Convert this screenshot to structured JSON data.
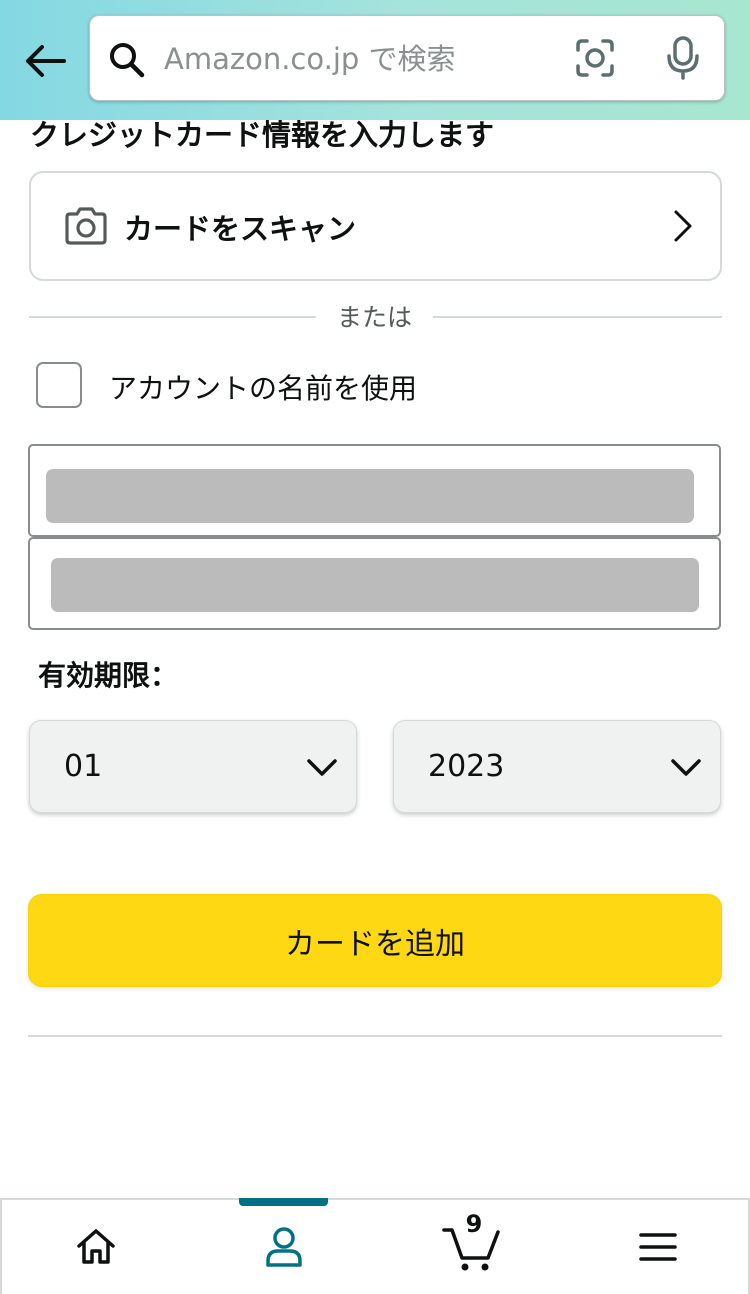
{
  "header": {
    "search_placeholder": "Amazon.co.jp で検索",
    "icons": [
      "back-arrow-icon",
      "search-icon",
      "camera-lens-icon",
      "microphone-icon"
    ]
  },
  "page": {
    "title": "クレジットカード情報を入力します"
  },
  "scan_card": {
    "label": "カードをスキャン",
    "icons": [
      "camera-icon",
      "chevron-right-icon"
    ]
  },
  "divider": {
    "text": "または"
  },
  "account_name": {
    "label": "アカウントの名前を使用",
    "checked": false
  },
  "card_fields": {
    "card_number_value": "",
    "card_name_value": ""
  },
  "expiry": {
    "label": "有効期限：",
    "month": "01",
    "year": "2023"
  },
  "actions": {
    "add_card_label": "カードを追加"
  },
  "bottom_nav": {
    "items": [
      "home-icon",
      "account-icon",
      "cart-icon",
      "menu-icon"
    ],
    "active": "account",
    "cart_count": "9"
  },
  "colors": {
    "accent": "#007185",
    "button_primary": "#FFD814",
    "header_gradient_start": "#84D8E3",
    "header_gradient_end": "#A7E6CF",
    "text": "#0F1111"
  }
}
